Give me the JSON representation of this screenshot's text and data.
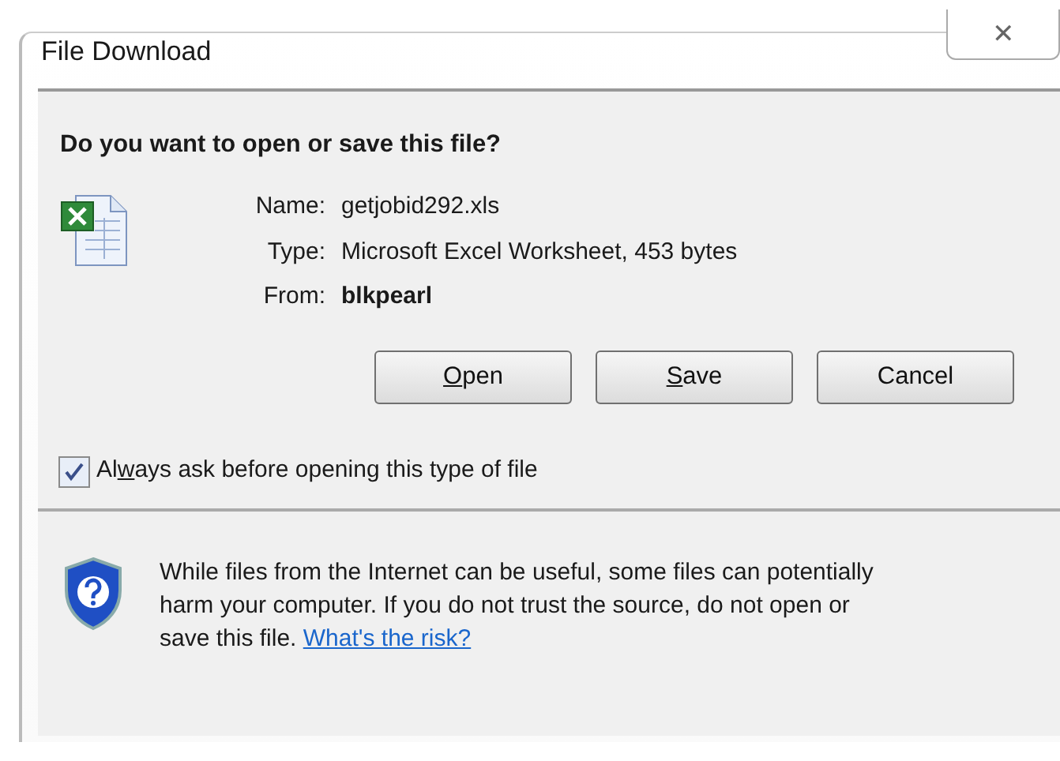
{
  "window": {
    "title": "File Download",
    "close": "✕"
  },
  "question": "Do you want to open or save this file?",
  "file": {
    "fields": [
      {
        "label": "Name:",
        "value": "getjobid292.xls",
        "bold": false
      },
      {
        "label": "Type:",
        "value": "Microsoft Excel Worksheet, 453 bytes",
        "bold": false
      },
      {
        "label": "From:",
        "value": "blkpearl",
        "bold": true
      }
    ]
  },
  "buttons": [
    {
      "label": [
        {
          "text": "O",
          "underlined": true
        },
        {
          "text": "pen",
          "underlined": false
        }
      ]
    },
    {
      "label": [
        {
          "text": "S",
          "underlined": true
        },
        {
          "text": "ave",
          "underlined": false
        }
      ]
    },
    {
      "label": [
        {
          "text": "Cancel",
          "underlined": false
        }
      ]
    }
  ],
  "always_ask": {
    "label": [
      {
        "text": "Al",
        "underlined": false
      },
      {
        "text": "w",
        "underlined": true
      },
      {
        "text": "ays ask before opening this type of file",
        "underlined": false
      }
    ],
    "checked": true
  },
  "note": {
    "text": "While files from the Internet can be useful, some files can potentially harm your computer. If you do not trust the source, do not open or save this file.",
    "link": "What's the risk?"
  }
}
